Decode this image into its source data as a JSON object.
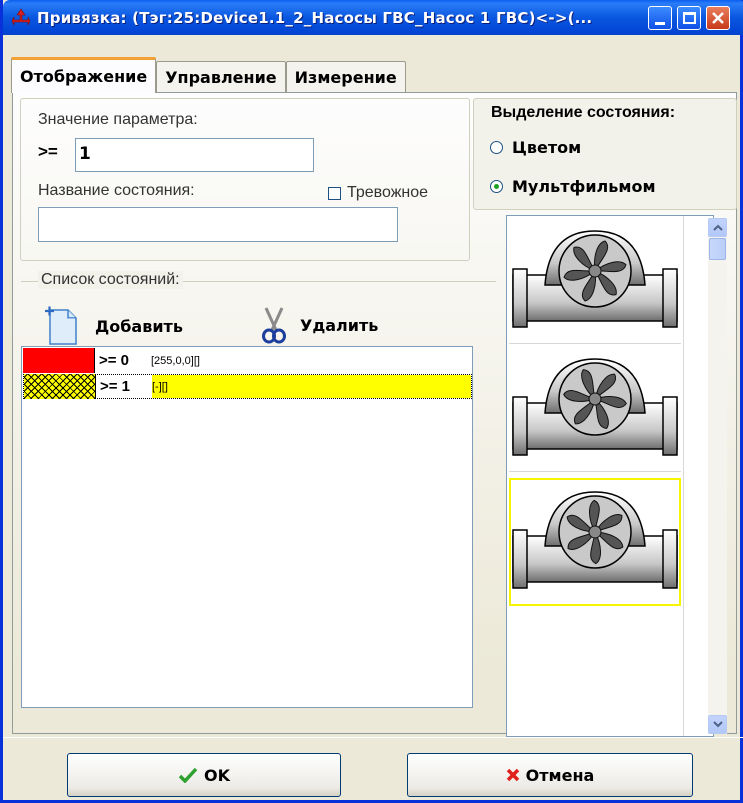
{
  "window": {
    "title": "Привязка: (Тэг:25:Device1.1_2_Насосы ГВС_Насос 1 ГВС)<->(..."
  },
  "tabs": [
    {
      "label": "Отображение",
      "active": true
    },
    {
      "label": "Управление",
      "active": false
    },
    {
      "label": "Измерение",
      "active": false
    }
  ],
  "param": {
    "label": "Значение параметра:",
    "operator": ">=",
    "value": "1"
  },
  "state": {
    "name_label": "Название состояния:",
    "name_value": "",
    "alarm_label": "Тревожное",
    "alarm_checked": false
  },
  "highlight": {
    "title": "Выделение состояния:",
    "options": [
      {
        "label": "Цветом",
        "selected": false
      },
      {
        "label": "Мультфильмом",
        "selected": true
      }
    ]
  },
  "states_list": {
    "title": "Список состояний:",
    "add_label": "Добавить",
    "delete_label": "Удалить",
    "rows": [
      {
        "cond": ">= 0",
        "desc": "[255,0,0][]",
        "swatch": "#FF0000",
        "selected": false
      },
      {
        "cond": ">= 1",
        "desc": "[-][]",
        "swatch": "hatch-yellow",
        "selected": true
      }
    ]
  },
  "animation_frames": [
    {
      "icon": "fan-pump-icon",
      "selected": false
    },
    {
      "icon": "fan-pump-icon",
      "selected": false
    },
    {
      "icon": "fan-pump-icon",
      "selected": true
    }
  ],
  "footer": {
    "ok_label": "OK",
    "cancel_label": "Отмена"
  },
  "colors": {
    "titlebar": "#0A57E0",
    "selection": "#FFFF00",
    "ok_check": "#2EA02E",
    "cancel_x": "#E0201B"
  }
}
